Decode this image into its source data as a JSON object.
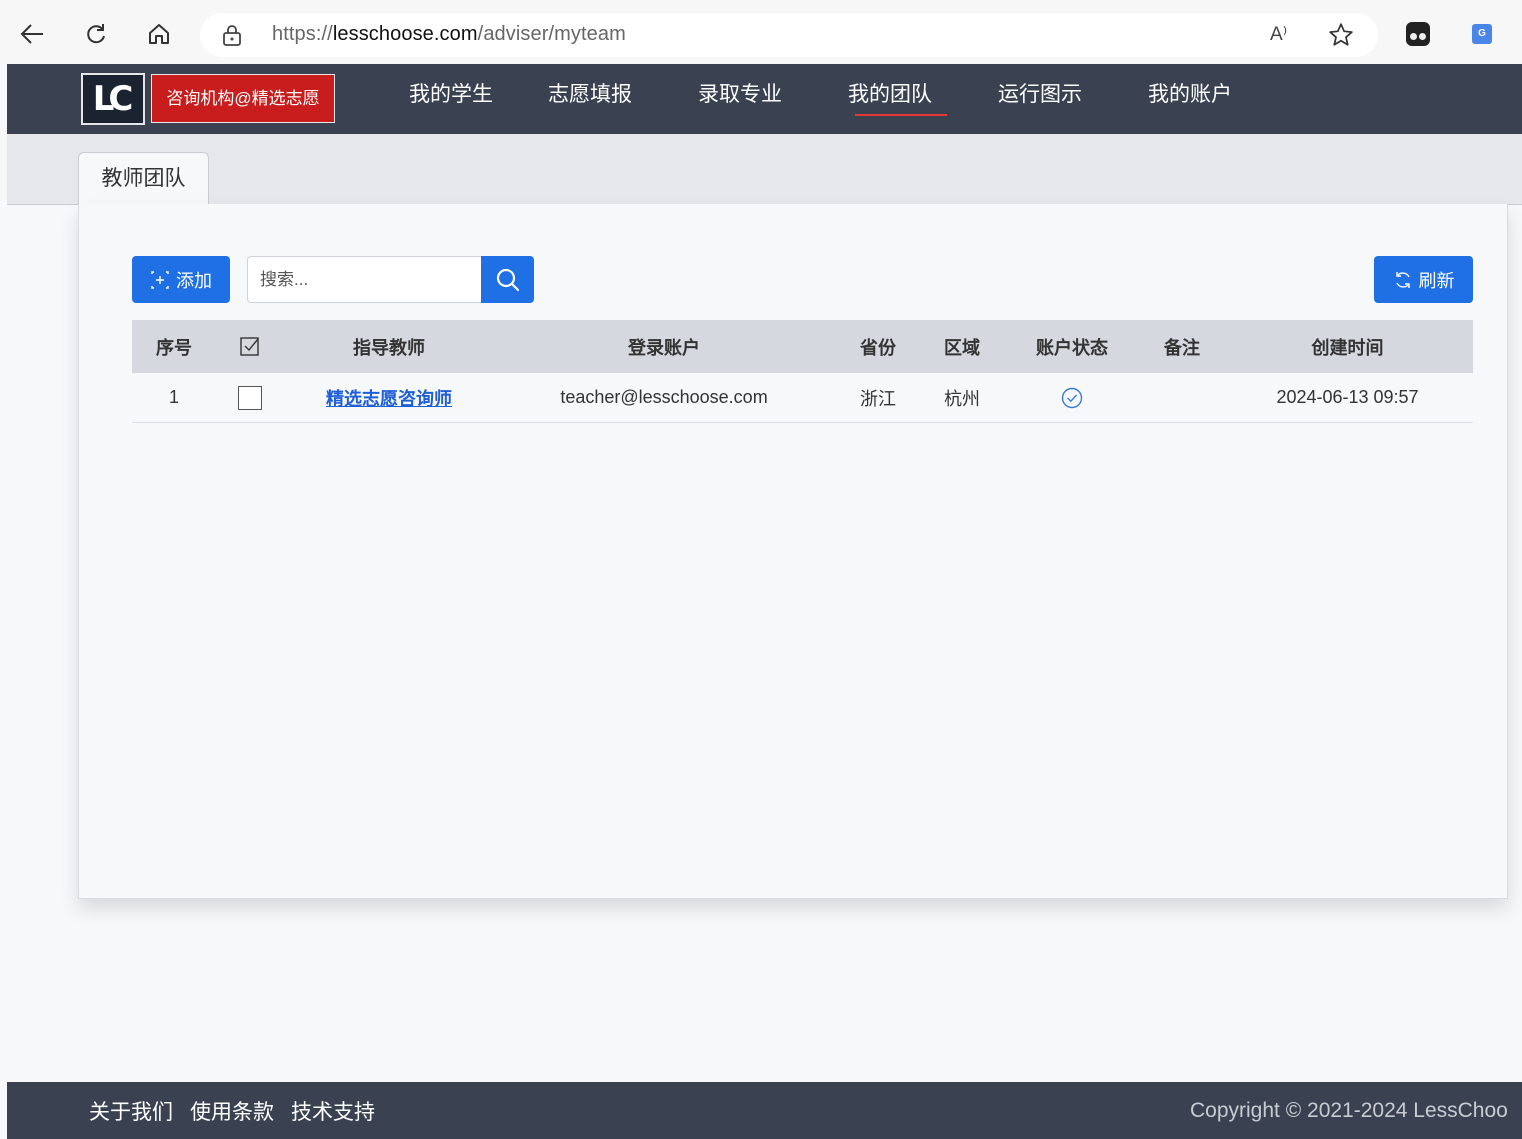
{
  "browser": {
    "url_prefix": "https://",
    "url_domain": "lesschoose.com",
    "url_path": "/adviser/myteam",
    "read_aloud": "A⁾"
  },
  "header": {
    "logo_text": "LC",
    "org_badge": "咨询机构@精选志愿",
    "nav": [
      {
        "label": "我的学生"
      },
      {
        "label": "志愿填报"
      },
      {
        "label": "录取专业"
      },
      {
        "label": "我的团队",
        "active": true
      },
      {
        "label": "运行图示"
      },
      {
        "label": "我的账户"
      }
    ]
  },
  "tabs": [
    {
      "label": "教师团队",
      "active": true
    }
  ],
  "toolbar": {
    "add_label": "添加",
    "search_placeholder": "搜索...",
    "refresh_label": "刷新"
  },
  "table": {
    "headers": {
      "no": "序号",
      "teacher": "指导教师",
      "account": "登录账户",
      "province": "省份",
      "region": "区域",
      "status": "账户状态",
      "note": "备注",
      "created": "创建时间"
    },
    "rows": [
      {
        "no": "1",
        "teacher": "精选志愿咨询师",
        "account": "teacher@lesschoose.com",
        "province": "浙江",
        "region": "杭州",
        "status": "active",
        "note": "",
        "created": "2024-06-13 09:57"
      }
    ]
  },
  "footer": {
    "links": [
      "关于我们",
      "使用条款",
      "技术支持"
    ],
    "copyright": "Copyright © 2021-2024 LessChoo"
  },
  "colors": {
    "header_bg": "#3a4252",
    "accent_blue": "#1f6fe5",
    "badge_red": "#c91d1d",
    "active_underline": "#e53935"
  }
}
